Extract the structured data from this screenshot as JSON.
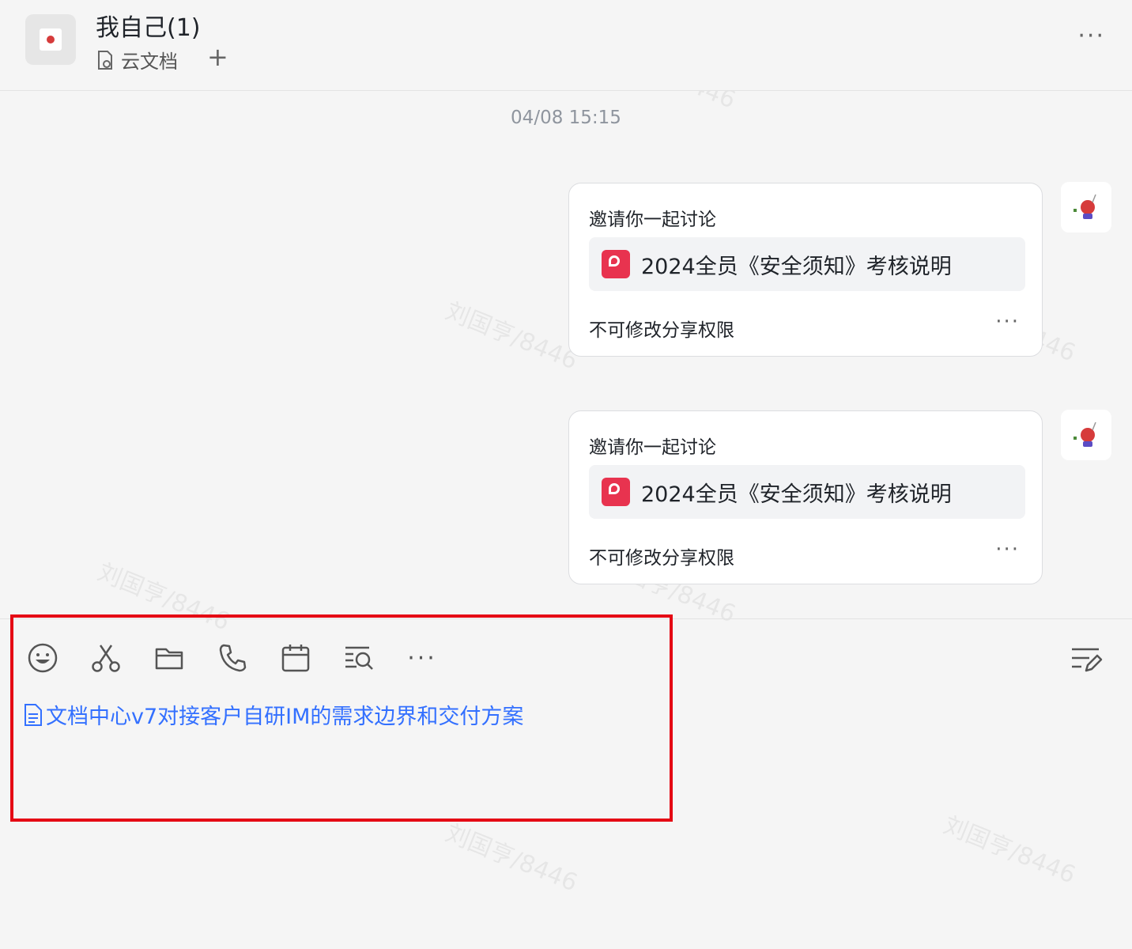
{
  "header": {
    "title": "我自己(1)",
    "tab_label": "云文档",
    "plus_symbol": "+",
    "more_symbol": "···"
  },
  "watermark": "刘国亨/8446",
  "timestamp": "04/08 15:15",
  "messages": [
    {
      "title": "邀请你一起讨论",
      "doc_name": "2024全员《安全须知》考核说明",
      "permission": "不可修改分享权限",
      "more_symbol": "···"
    },
    {
      "title": "邀请你一起讨论",
      "doc_name": "2024全员《安全须知》考核说明",
      "permission": "不可修改分享权限",
      "more_symbol": "···"
    }
  ],
  "composer": {
    "tools": [
      "emoji-icon",
      "scissors-icon",
      "folder-icon",
      "phone-icon",
      "calendar-icon",
      "search-list-icon",
      "more-icon"
    ],
    "more_symbol": "···",
    "draft_link": "文档中心v7对接客户自研IM的需求边界和交付方案"
  },
  "colors": {
    "accent_link": "#3370ff",
    "highlight_border": "#e50914",
    "doc_icon": "#e8334f"
  }
}
